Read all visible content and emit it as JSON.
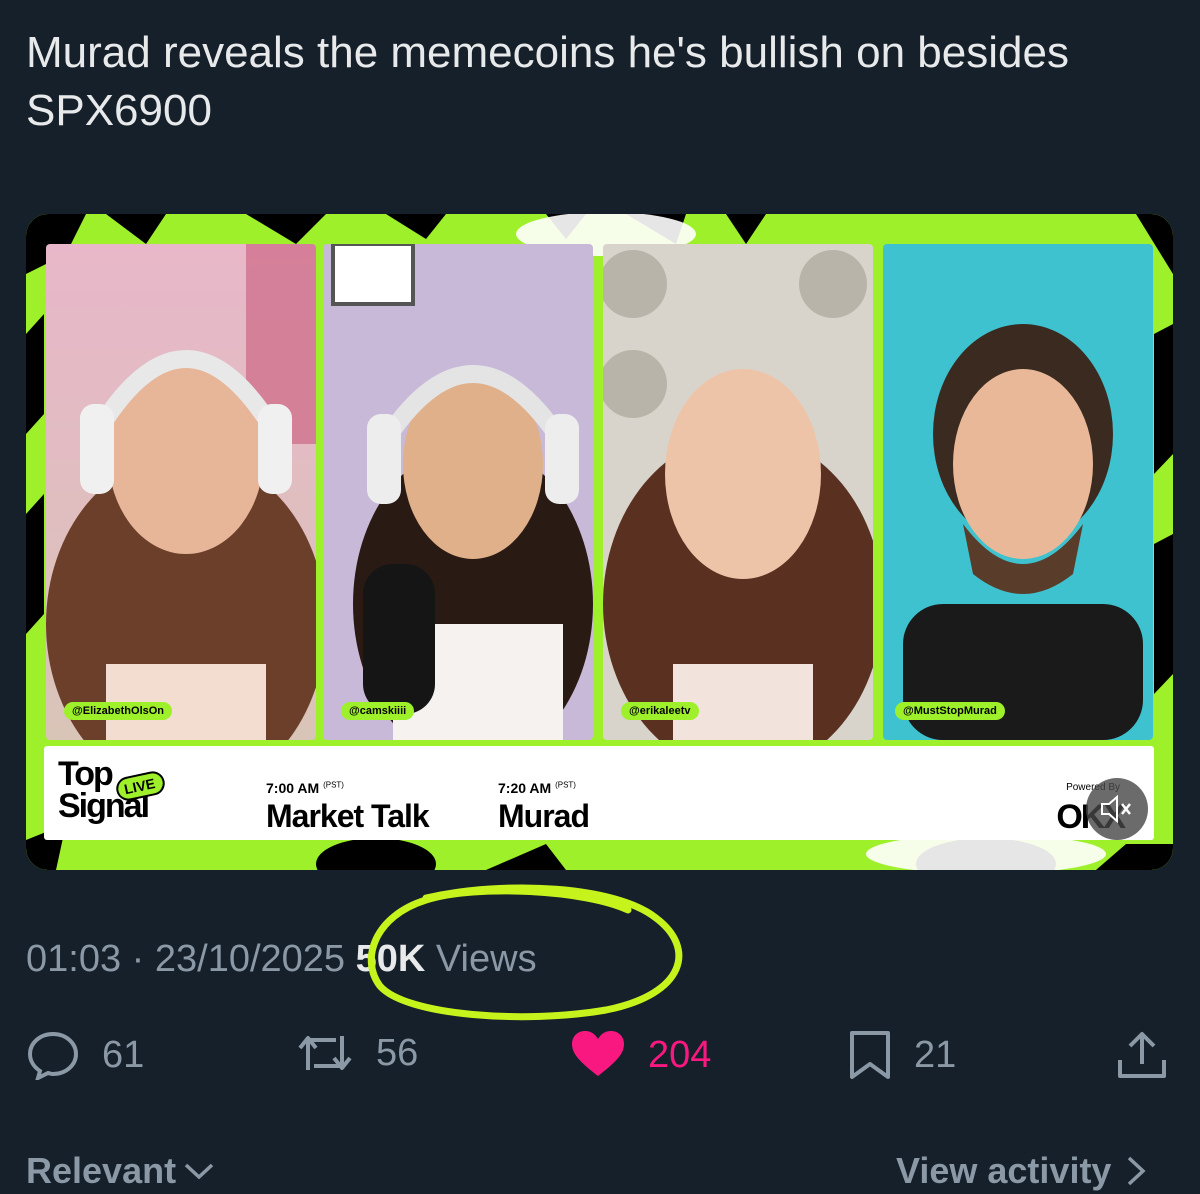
{
  "tweet": {
    "text": "Murad reveals the memecoins he's bullish on besides SPX6900"
  },
  "media": {
    "accent_color": "#9ef02b",
    "handles": [
      "@ElizabethOlsOn",
      "@camskiiii",
      "@erikaleetv",
      "@MustStopMurad"
    ],
    "brand_line1": "Top",
    "brand_line2": "Signal",
    "live_label": "LIVE",
    "schedule": [
      {
        "time": "7:00 AM",
        "tz": "(PST)",
        "title": "Market Talk"
      },
      {
        "time": "7:20 AM",
        "tz": "(PST)",
        "title": "Murad"
      }
    ],
    "powered_by": "Powered By",
    "sponsor": "OKX",
    "mute_icon": "speaker-muted-icon"
  },
  "meta": {
    "time": "01:03",
    "separator": " · ",
    "date": "23/10/2025",
    "views_count": "50K",
    "views_label": " Views",
    "highlight_color": "#c6f31c"
  },
  "actions": {
    "replies": "61",
    "reposts": "56",
    "likes": "204",
    "bookmarks": "21",
    "like_color": "#f91880"
  },
  "footer": {
    "sort_label": "Relevant",
    "view_activity": "View activity"
  }
}
